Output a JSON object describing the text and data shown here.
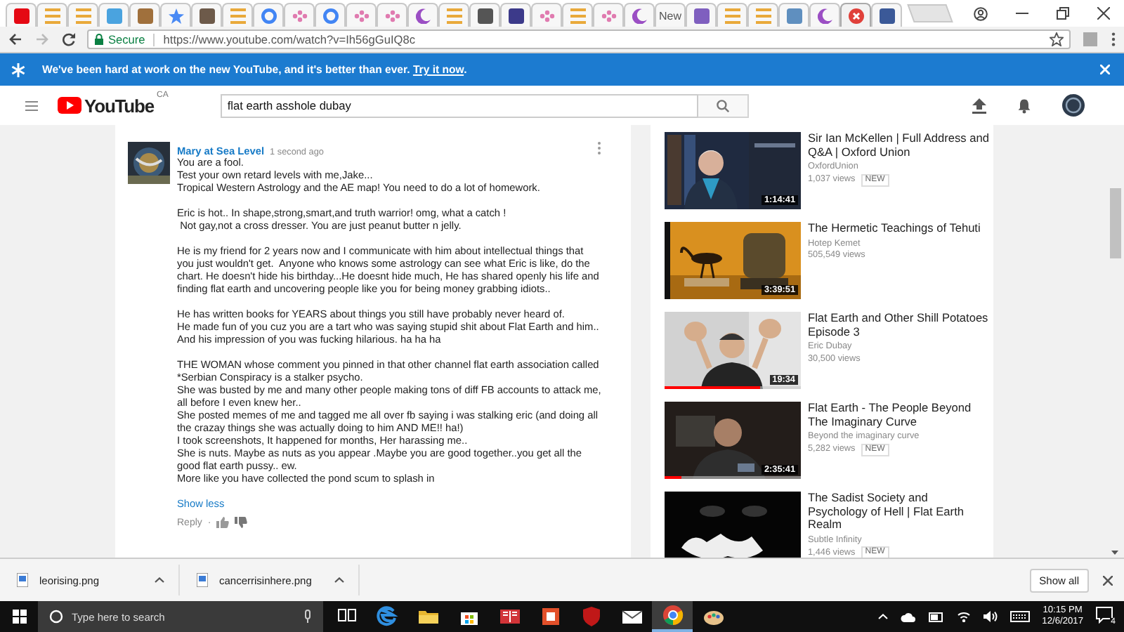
{
  "browser": {
    "tabs": [
      {
        "kind": "square",
        "color": "#e50914",
        "selected": false
      },
      {
        "kind": "stripes",
        "color": "#e9a93a",
        "selected": false
      },
      {
        "kind": "stripes",
        "color": "#e9a93a",
        "selected": false
      },
      {
        "kind": "square",
        "color": "#4aa3df",
        "selected": false
      },
      {
        "kind": "square",
        "color": "#a0703c",
        "selected": false
      },
      {
        "kind": "star",
        "color": "#4a8af4",
        "selected": false
      },
      {
        "kind": "square",
        "color": "#6d5a4a",
        "selected": false
      },
      {
        "kind": "stripes",
        "color": "#e9a93a",
        "selected": false
      },
      {
        "kind": "ring",
        "color": "#4285f4",
        "selected": false
      },
      {
        "kind": "dots",
        "color": "#e07bb0",
        "selected": false
      },
      {
        "kind": "ring",
        "color": "#4285f4",
        "selected": false
      },
      {
        "kind": "dots",
        "color": "#e07bb0",
        "selected": false
      },
      {
        "kind": "dots",
        "color": "#e07bb0",
        "selected": false
      },
      {
        "kind": "moon",
        "color": "#9b4fc4",
        "selected": false
      },
      {
        "kind": "stripes",
        "color": "#e9a93a",
        "selected": false
      },
      {
        "kind": "square",
        "color": "#555555",
        "selected": false
      },
      {
        "kind": "square",
        "color": "#3c3a8a",
        "selected": false
      },
      {
        "kind": "dots",
        "color": "#e07bb0",
        "selected": false
      },
      {
        "kind": "stripes",
        "color": "#e9a93a",
        "selected": false
      },
      {
        "kind": "dots",
        "color": "#e07bb0",
        "selected": false
      },
      {
        "kind": "moon",
        "color": "#9b4fc4",
        "selected": false
      },
      {
        "kind": "text",
        "label": "New",
        "selected": false
      },
      {
        "kind": "square",
        "color": "#7f5fbf",
        "selected": false
      },
      {
        "kind": "stripes",
        "color": "#e9a93a",
        "selected": false
      },
      {
        "kind": "stripes",
        "color": "#e9a93a",
        "selected": false
      },
      {
        "kind": "square",
        "color": "#5f8fbf",
        "selected": false
      },
      {
        "kind": "moon",
        "color": "#9b4fc4",
        "selected": false
      },
      {
        "kind": "xcircle",
        "color": "#e0403a",
        "selected": true
      },
      {
        "kind": "square",
        "color": "#3b5998",
        "selected": false
      }
    ],
    "address_bar": {
      "secure_label": "Secure",
      "url": "https://www.youtube.com/watch?v=Ih56gGuIQ8c"
    }
  },
  "banner": {
    "text": "We've been hard at work on the new YouTube, and it's better than ever.",
    "link": "Try it now",
    "trailing": "."
  },
  "header": {
    "logo_text": "YouTube",
    "region": "CA",
    "search_value": "flat earth asshole dubay"
  },
  "comment": {
    "author": "Mary at Sea Level",
    "time": "1 second ago",
    "paragraphs": [
      [
        "You are a fool.",
        "Test your own retard levels with me,Jake...",
        "Tropical Western Astrology and the AE map! You need to do a lot of homework."
      ],
      [
        "Eric is hot.. In shape,strong,smart,and truth warrior! omg, what a catch !",
        " Not gay,not a cross dresser. You are just peanut butter n jelly."
      ],
      [
        "He is my friend for 2 years now and I communicate with him about intellectual things that you just wouldn't get.  Anyone who knows some astrology can see what Eric is like, do the chart. He doesn't hide his birthday...He doesnt hide much, He has shared openly his life and finding flat earth and uncovering people like you for being money grabbing idiots.."
      ],
      [
        "He has written books for YEARS about things you still have probably never heard of.",
        "He made fun of you cuz you are a tart who was saying stupid shit about Flat Earth and him.. And his impression of you was fucking hilarious. ha ha ha"
      ],
      [
        "THE WOMAN whose comment you pinned in that other channel flat earth association called *Serbian Conspiracy is a stalker psycho.",
        "She was busted by me and many other people making tons of diff FB accounts to attack me, all before I even knew her..",
        "She posted memes of me and tagged me all over fb saying i was stalking eric (and doing all the crazay things she was actually doing to him AND ME!! ha!)",
        "I took screenshots, It happened for months, Her harassing me..",
        "She is nuts. Maybe as nuts as you appear .Maybe you are good together..you get all the good flat earth pussy.. ew.",
        "More like you have collected the pond scum to splash in"
      ]
    ],
    "show_less": "Show less",
    "reply": "Reply",
    "separator": "·"
  },
  "sidebar": {
    "videos": [
      {
        "title": "Sir Ian McKellen | Full Address and Q&A | Oxford Union",
        "channel": "OxfordUnion",
        "views": "1,037 views",
        "badge": "NEW",
        "duration": "1:14:41"
      },
      {
        "title": "The Hermetic Teachings of Tehuti",
        "channel": "Hotep Kemet",
        "views": "505,549 views",
        "duration": "3:39:51"
      },
      {
        "title": "Flat Earth and Other Shill Potatoes Episode 3",
        "channel": "Eric Dubay",
        "views": "30,500 views",
        "duration": "19:34",
        "level": 0.7
      },
      {
        "title": "Flat Earth - The People Beyond The Imaginary Curve",
        "channel": "Beyond the imaginary curve",
        "views": "5,282 views",
        "badge": "NEW",
        "duration": "2:35:41",
        "level": 0.12
      },
      {
        "title": "The Sadist Society and Psychology of Hell | Flat Earth Realm",
        "channel": "Subtle Infinity",
        "views": "1,446 views",
        "badge": "NEW"
      }
    ]
  },
  "downloads": {
    "files": [
      {
        "name": "leorising.png"
      },
      {
        "name": "cancerrisinhere.png"
      }
    ],
    "show_all": "Show all"
  },
  "taskbar": {
    "search_placeholder": "Type here to search",
    "apps": [
      {
        "kind": "taskview",
        "selected": false
      },
      {
        "kind": "edge",
        "selected": false
      },
      {
        "kind": "explorer",
        "selected": false
      },
      {
        "kind": "store",
        "selected": false
      },
      {
        "kind": "reader",
        "selected": false
      },
      {
        "kind": "office",
        "selected": false
      },
      {
        "kind": "shield",
        "selected": false
      },
      {
        "kind": "mail",
        "selected": false
      },
      {
        "kind": "chrome",
        "selected": true
      },
      {
        "kind": "paint",
        "selected": false
      }
    ],
    "time": "10:15 PM",
    "date": "12/6/2017",
    "notifications": "4"
  }
}
